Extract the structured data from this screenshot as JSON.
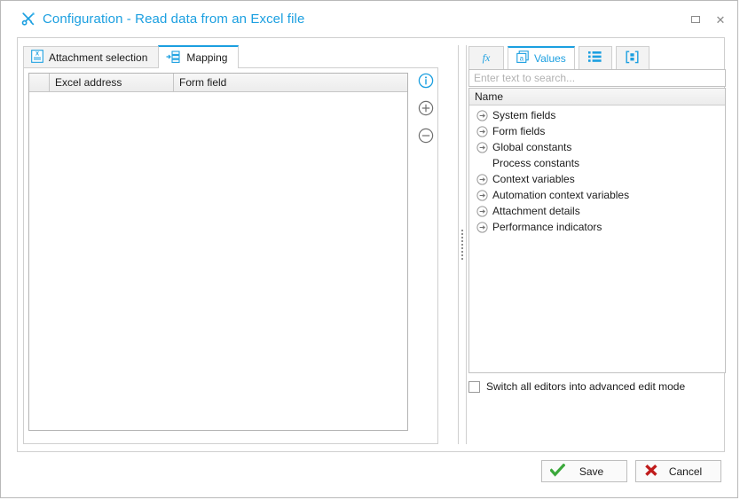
{
  "window": {
    "title": "Configuration - Read data from an Excel file",
    "title_icon": "tools-icon",
    "accent_color": "#1b9fe0",
    "controls": {
      "maximize": "maximize-icon",
      "close": "close-icon"
    }
  },
  "left_panel": {
    "tabs": [
      {
        "label": "Attachment selection",
        "icon": "excel-document-icon",
        "active": false
      },
      {
        "label": "Mapping",
        "icon": "mapping-arrow-list-icon",
        "active": true
      }
    ],
    "grid": {
      "columns": [
        "",
        "Excel address",
        "Form field"
      ],
      "rows": []
    },
    "actions": [
      {
        "name": "info-icon",
        "color": "#1b9fe0"
      },
      {
        "name": "plus-circle-icon",
        "color": "#6f6f6f"
      },
      {
        "name": "minus-circle-icon",
        "color": "#6f6f6f"
      }
    ]
  },
  "right_panel": {
    "tabs": [
      {
        "label": "",
        "icon": "fx-function-icon",
        "active": false
      },
      {
        "label": "Values",
        "icon": "values-a-icon",
        "active": true
      },
      {
        "label": "",
        "icon": "bullet-list-icon",
        "active": false
      },
      {
        "label": "",
        "icon": "bracket-box-icon",
        "active": false
      }
    ],
    "search": {
      "value": "",
      "placeholder": "Enter text to search..."
    },
    "tree": {
      "header": "Name",
      "items": [
        {
          "label": "System fields",
          "expandable": true
        },
        {
          "label": "Form fields",
          "expandable": true
        },
        {
          "label": "Global constants",
          "expandable": true
        },
        {
          "label": "Process constants",
          "expandable": false
        },
        {
          "label": "Context variables",
          "expandable": true
        },
        {
          "label": "Automation context variables",
          "expandable": true
        },
        {
          "label": "Attachment details",
          "expandable": true
        },
        {
          "label": "Performance indicators",
          "expandable": true
        }
      ]
    },
    "advanced_mode": {
      "label": "Switch all editors into advanced edit mode",
      "checked": false
    }
  },
  "footer": {
    "save_label": "Save",
    "cancel_label": "Cancel",
    "save_icon": "green-check-icon",
    "cancel_icon": "red-cross-icon"
  }
}
